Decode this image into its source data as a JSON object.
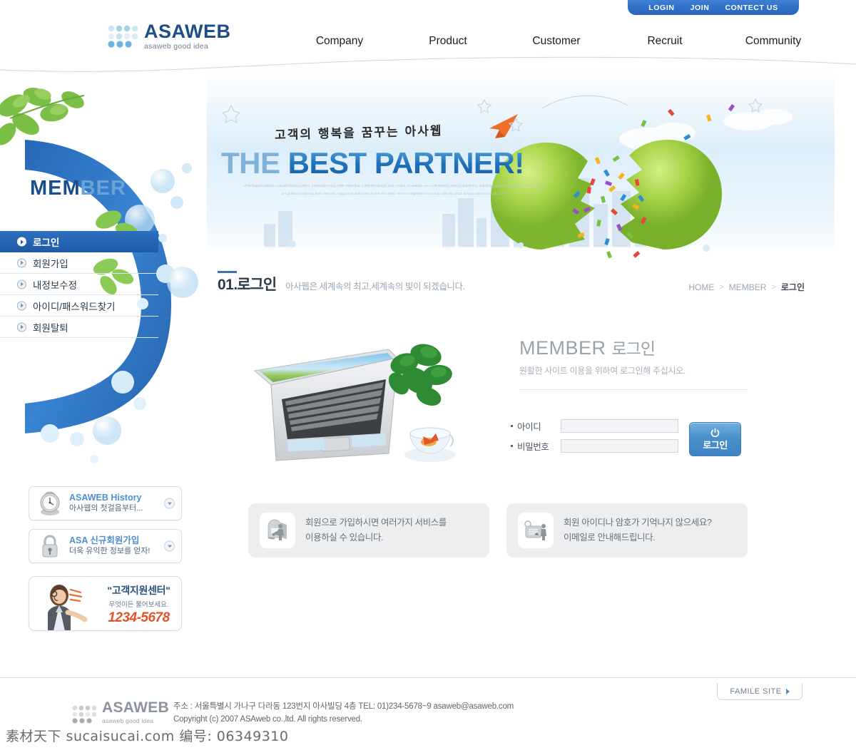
{
  "topbar": {
    "links": [
      {
        "label": "LOGIN"
      },
      {
        "label": "JOIN"
      },
      {
        "label": "CONTECT US"
      }
    ],
    "bg_color": "#2f6fc6"
  },
  "header": {
    "logo_title": "ASAWEB",
    "logo_tagline": "asaweb good idea",
    "nav": [
      {
        "label": "Company"
      },
      {
        "label": "Product"
      },
      {
        "label": "Customer"
      },
      {
        "label": "Recruit"
      },
      {
        "label": "Community"
      }
    ]
  },
  "sidebar": {
    "title_part1": "MEM",
    "title_part2": "BER",
    "menu": [
      {
        "label": "로그인",
        "active": true
      },
      {
        "label": "회원가입",
        "active": false
      },
      {
        "label": "내정보수정",
        "active": false
      },
      {
        "label": "아이디/패스워드찾기",
        "active": false
      },
      {
        "label": "회원탈퇴",
        "active": false
      }
    ],
    "banners": [
      {
        "title": "ASAWEB  History",
        "sub": "아사웹의 첫걸음부터..."
      },
      {
        "title": "ASA 신규회원가입",
        "sub": "더욱 유익한 정보를 얻자!"
      }
    ],
    "support": {
      "title": "\"고객지원센터\"",
      "sub": "무엇이든 물어보세요.",
      "phone": "1234-5678"
    }
  },
  "hero": {
    "handwriting": "고객의 행복을 꿈꾸는 아사웹",
    "main_light": "THE ",
    "main_bold": "BEST PARTNER!",
    "description": "of the biggest domain and web hosting sites in Korea since May 1999. More than 1,800,000 people have visited our website we e-web hosting, web programming, and homepage building services. We are very proud that our site has been cited ers, magazines and books all over the world.  We have registered more than 100,000 gTLD domain names such as .COM."
  },
  "page": {
    "number": "01",
    "dot": ".",
    "title": "로그인",
    "subtitle": "아사웹은 세계속의 최고,세계속의 빛이 되겠습니다.",
    "breadcrumb": [
      {
        "label": "HOME"
      },
      {
        "label": "MEMBER"
      },
      {
        "label": "로그인"
      }
    ]
  },
  "login": {
    "heading_en": "MEMBER",
    "heading_kr": "로그인",
    "subtitle": "원활한 사이트 이용을 위하여 로그인해 주십시오.",
    "fields": [
      {
        "label": "아이디",
        "value": "",
        "placeholder": ""
      },
      {
        "label": "비밀번호",
        "value": "",
        "placeholder": ""
      }
    ],
    "button_label": "로그인",
    "button_color": "#4a90cc"
  },
  "info_boxes": [
    {
      "line1": "회원으로 가입하시면 여러가지 서비스를",
      "line2": "이용하실 수 있습니다.",
      "icon": "door-person-icon"
    },
    {
      "line1": "회원 아이디나 암호가 기억나지 않으세요?",
      "line2": "이메일로 안내해드립니다.",
      "icon": "document-person-icon"
    }
  ],
  "footer": {
    "famile_site": "FAMILE SITE",
    "logo_title": "ASAWEB",
    "logo_tagline": "asaweb good idea",
    "address": "주소 : 서울특별시 가나구 다라동 123번지 아사빌딩 4층 TEL: 01)234-5678~9 asaweb@asaweb.com",
    "copyright": "Copyright (c) 2007 ASAweb  co.,ltd. All rights reserved."
  },
  "watermark": "素材天下 sucaisucai.com  编号: 06349310"
}
